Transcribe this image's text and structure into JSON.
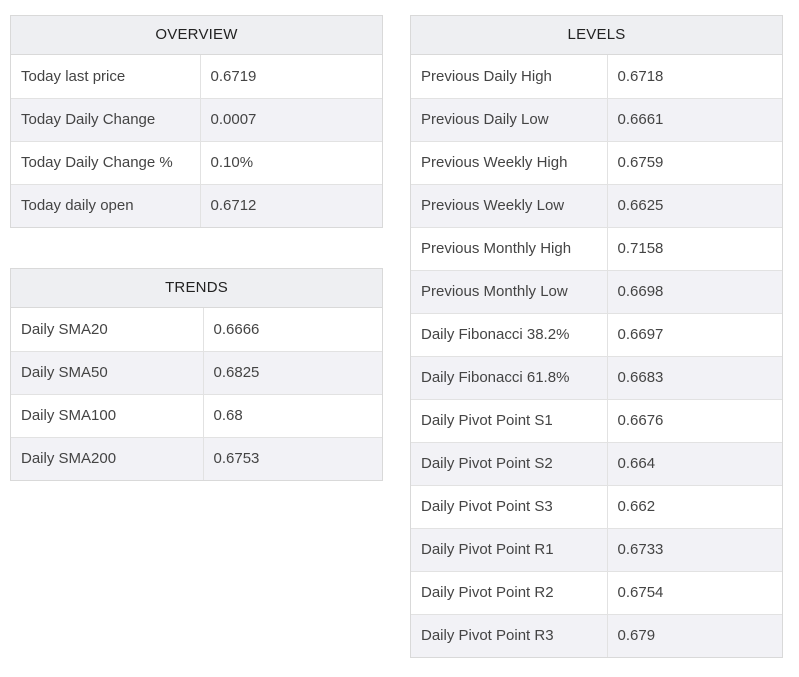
{
  "overview": {
    "title": "OVERVIEW",
    "rows": [
      {
        "label": "Today last price",
        "value": "0.6719"
      },
      {
        "label": "Today Daily Change",
        "value": "0.0007"
      },
      {
        "label": "Today Daily Change %",
        "value": "0.10%"
      },
      {
        "label": "Today daily open",
        "value": "0.6712"
      }
    ]
  },
  "trends": {
    "title": "TRENDS",
    "rows": [
      {
        "label": "Daily SMA20",
        "value": "0.6666"
      },
      {
        "label": "Daily SMA50",
        "value": "0.6825"
      },
      {
        "label": "Daily SMA100",
        "value": "0.68"
      },
      {
        "label": "Daily SMA200",
        "value": "0.6753"
      }
    ]
  },
  "levels": {
    "title": "LEVELS",
    "rows": [
      {
        "label": "Previous Daily High",
        "value": "0.6718"
      },
      {
        "label": "Previous Daily Low",
        "value": "0.6661"
      },
      {
        "label": "Previous Weekly High",
        "value": "0.6759"
      },
      {
        "label": "Previous Weekly Low",
        "value": "0.6625"
      },
      {
        "label": "Previous Monthly High",
        "value": "0.7158"
      },
      {
        "label": "Previous Monthly Low",
        "value": "0.6698"
      },
      {
        "label": "Daily Fibonacci 38.2%",
        "value": "0.6697"
      },
      {
        "label": "Daily Fibonacci 61.8%",
        "value": "0.6683"
      },
      {
        "label": "Daily Pivot Point S1",
        "value": "0.6676"
      },
      {
        "label": "Daily Pivot Point S2",
        "value": "0.664"
      },
      {
        "label": "Daily Pivot Point S3",
        "value": "0.662"
      },
      {
        "label": "Daily Pivot Point R1",
        "value": "0.6733"
      },
      {
        "label": "Daily Pivot Point R2",
        "value": "0.6754"
      },
      {
        "label": "Daily Pivot Point R3",
        "value": "0.679"
      }
    ]
  }
}
